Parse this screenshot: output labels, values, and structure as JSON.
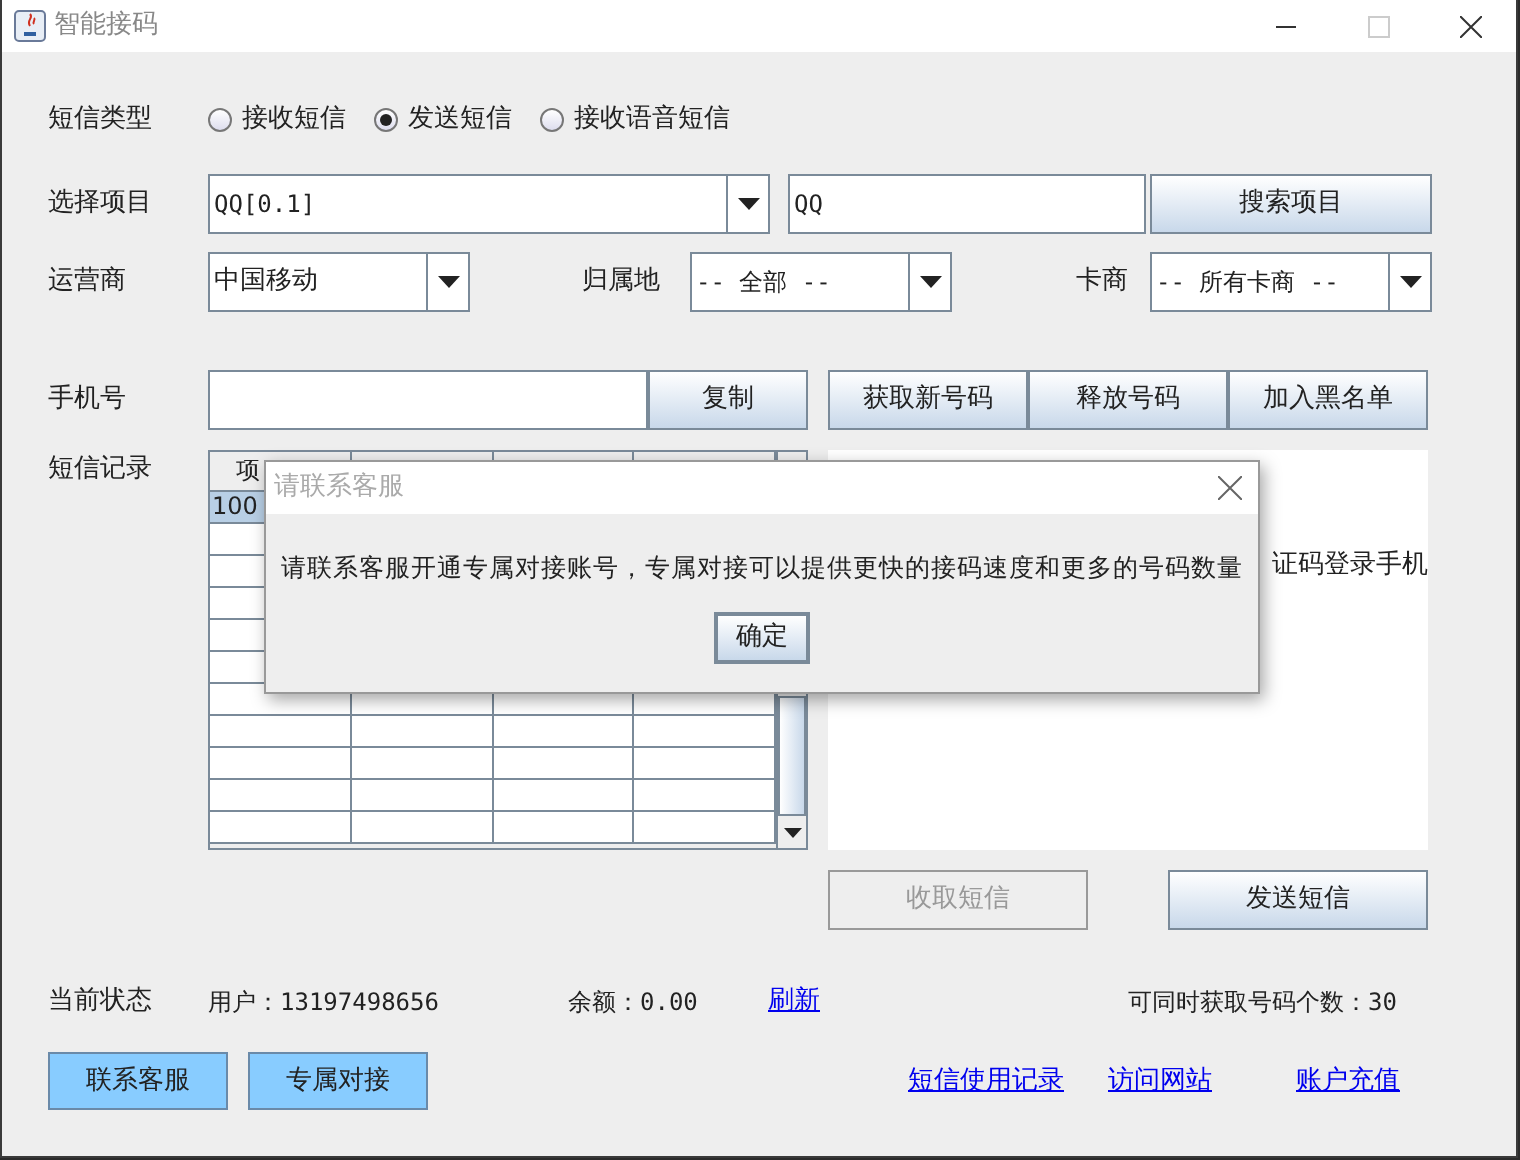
{
  "window": {
    "title": "智能接码"
  },
  "sms_type": {
    "label": "短信类型",
    "options": [
      {
        "label": "接收短信",
        "selected": false
      },
      {
        "label": "发送短信",
        "selected": true
      },
      {
        "label": "接收语音短信",
        "selected": false
      }
    ]
  },
  "project": {
    "label": "选择项目",
    "combo_value": "QQ[0.1]",
    "search_value": "QQ",
    "search_button": "搜索项目"
  },
  "carrier": {
    "label": "运营商",
    "value": "中国移动"
  },
  "region": {
    "label": "归属地",
    "value": "-- 全部 --"
  },
  "card_vendor": {
    "label": "卡商",
    "value": "-- 所有卡商 --"
  },
  "phone": {
    "label": "手机号",
    "copy_button": "复制"
  },
  "action_buttons": [
    "获取新号码",
    "释放号码",
    "加入黑名单"
  ],
  "records": {
    "label": "短信记录",
    "table": {
      "columns": [
        "项"
      ],
      "rows": [
        {
          "cells": [
            "100"
          ],
          "selected": true
        }
      ]
    },
    "message_lines": [
      "证码登录手机"
    ]
  },
  "sms_buttons": [
    {
      "label": "收取短信",
      "disabled": true
    },
    {
      "label": "发送短信",
      "disabled": false
    }
  ],
  "status": {
    "label": "当前状态",
    "user": "用户：13197498656",
    "balance": "余额：0.00",
    "refresh_link": "刷新",
    "max_numbers": "可同时获取号码个数：30"
  },
  "footer_buttons": [
    "联系客服",
    "专属对接"
  ],
  "links": [
    "短信使用记录",
    "访问网站",
    "账户充值"
  ],
  "dialog": {
    "title": "请联系客服",
    "message": "请联系客服开通专属对接账号，专属对接可以提供更快的接码速度和更多的号码数量",
    "ok_button": "确定"
  }
}
